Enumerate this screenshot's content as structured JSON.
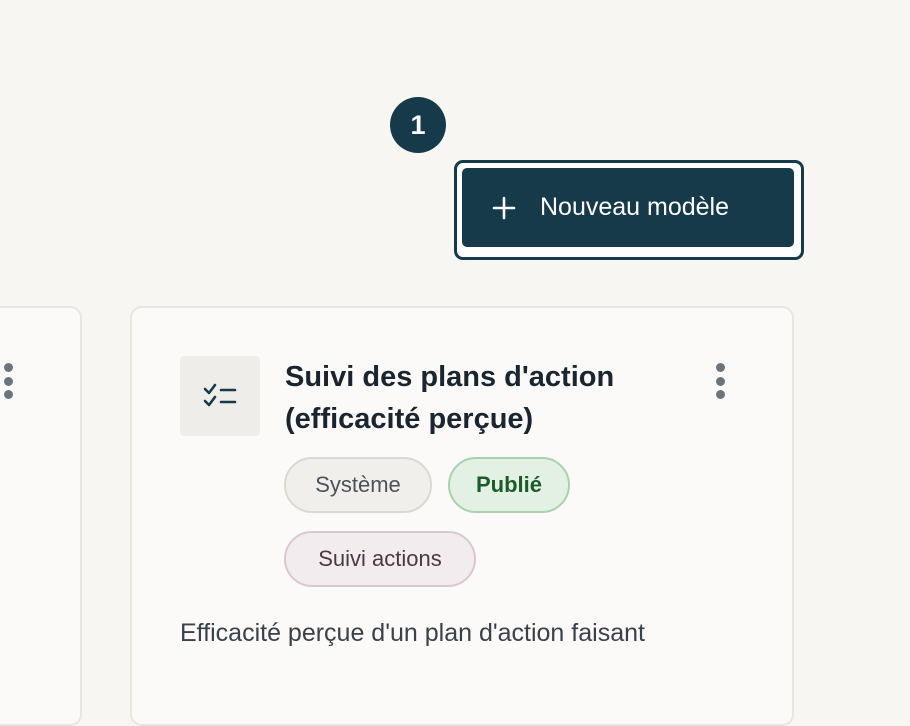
{
  "step_marker": {
    "number": "1"
  },
  "toolbar": {
    "new_template_label": "Nouveau modèle",
    "new_template_icon": "plus-icon"
  },
  "cards": [
    {
      "title": "Suivi des plans d'action (efficacité perçue)",
      "icon": "checklist-icon",
      "tags": [
        "Système",
        "Publié",
        "Suivi actions"
      ],
      "description": "Efficacité perçue d'un plan d'action faisant"
    }
  ],
  "colors": {
    "accent": "#173a4b",
    "page_background": "#f7f6f3",
    "published_tag": "#1d5b2c"
  }
}
